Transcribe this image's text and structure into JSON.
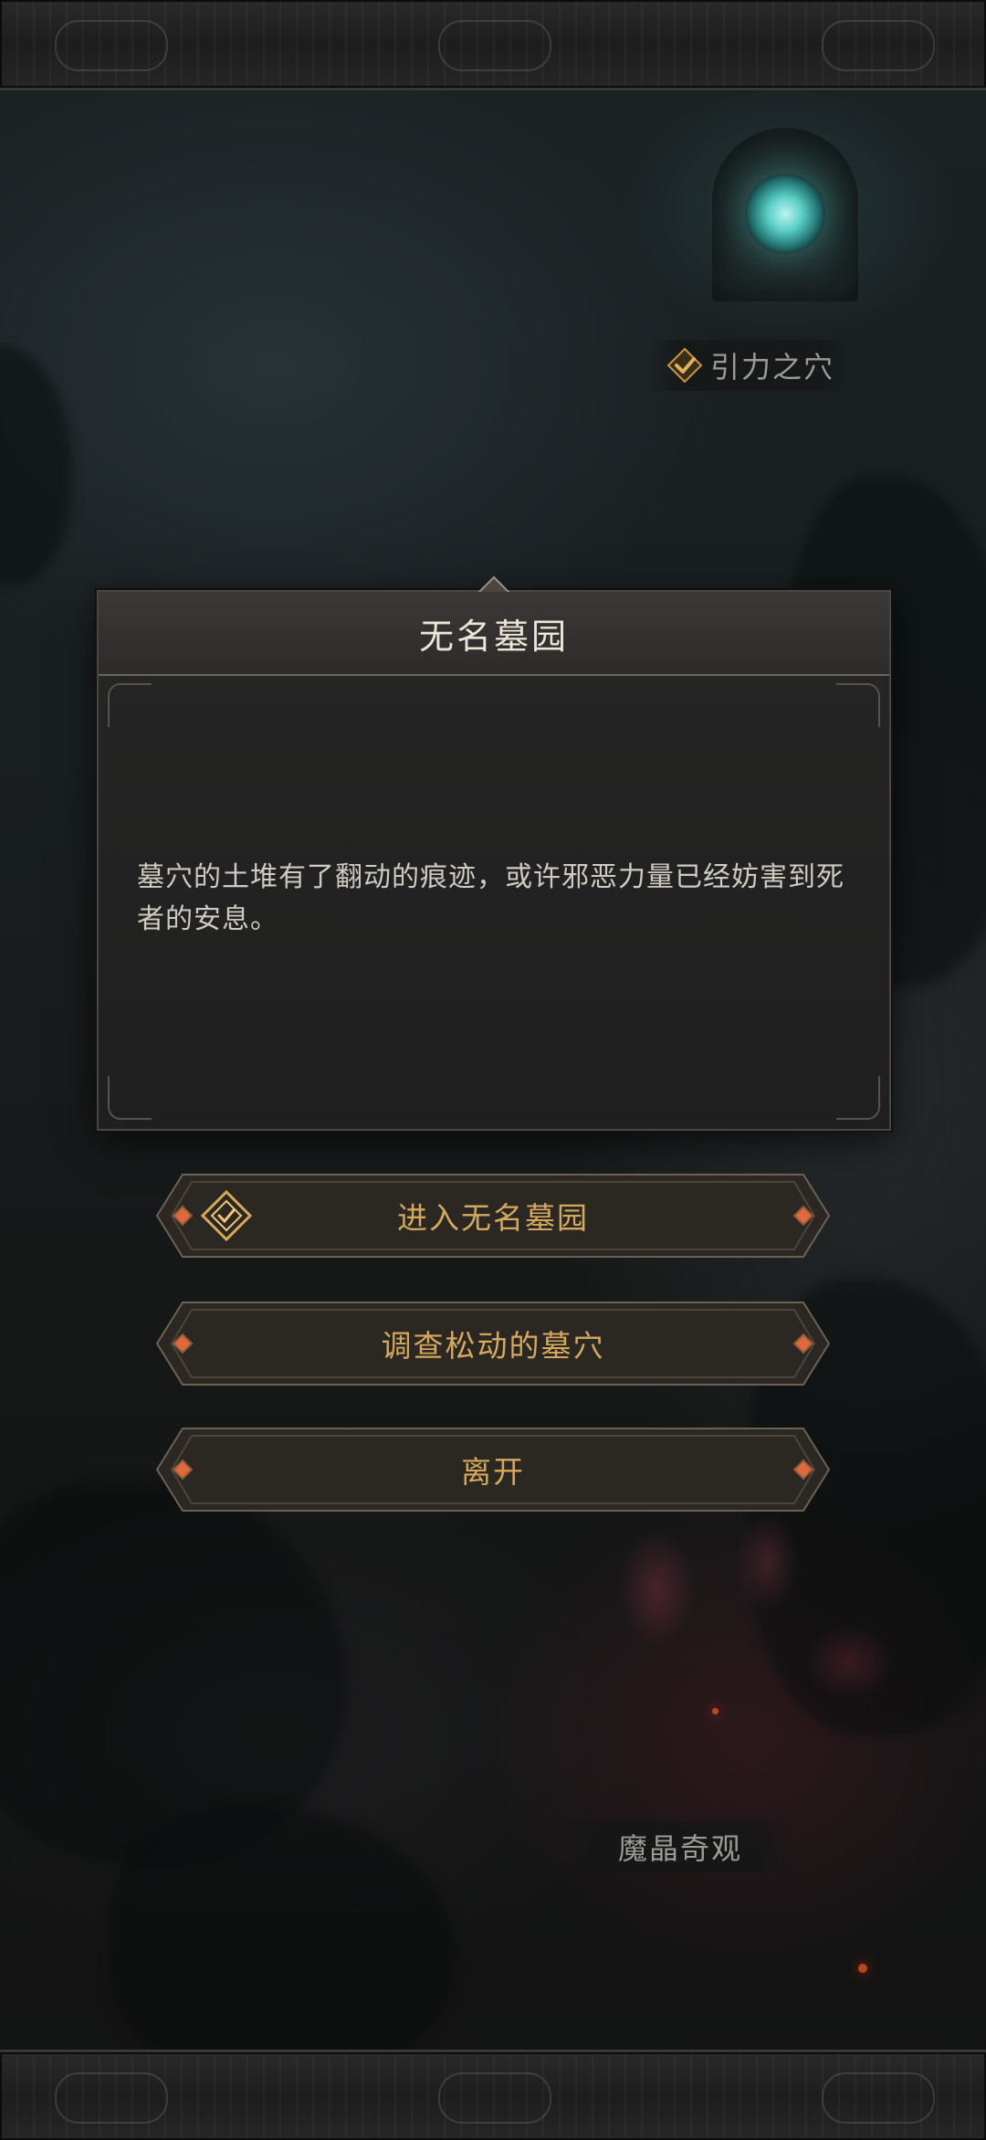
{
  "map": {
    "locations": [
      {
        "label": "引力之穴",
        "cleared": true
      },
      {
        "label": "魔晶奇观",
        "cleared": false
      }
    ]
  },
  "event": {
    "title": "无名墓园",
    "description": "墓穴的土堆有了翻动的痕迹，或许邪恶力量已经妨害到死者的安息。",
    "options": [
      {
        "label": "进入无名墓园",
        "icon": "enter-dungeon-icon"
      },
      {
        "label": "调查松动的墓穴"
      },
      {
        "label": "离开"
      }
    ]
  },
  "colors": {
    "option_text": "#d4a95e",
    "option_gem": "#e0683a",
    "check_gold": "#c9953e",
    "portal": "#5bcfc6"
  }
}
